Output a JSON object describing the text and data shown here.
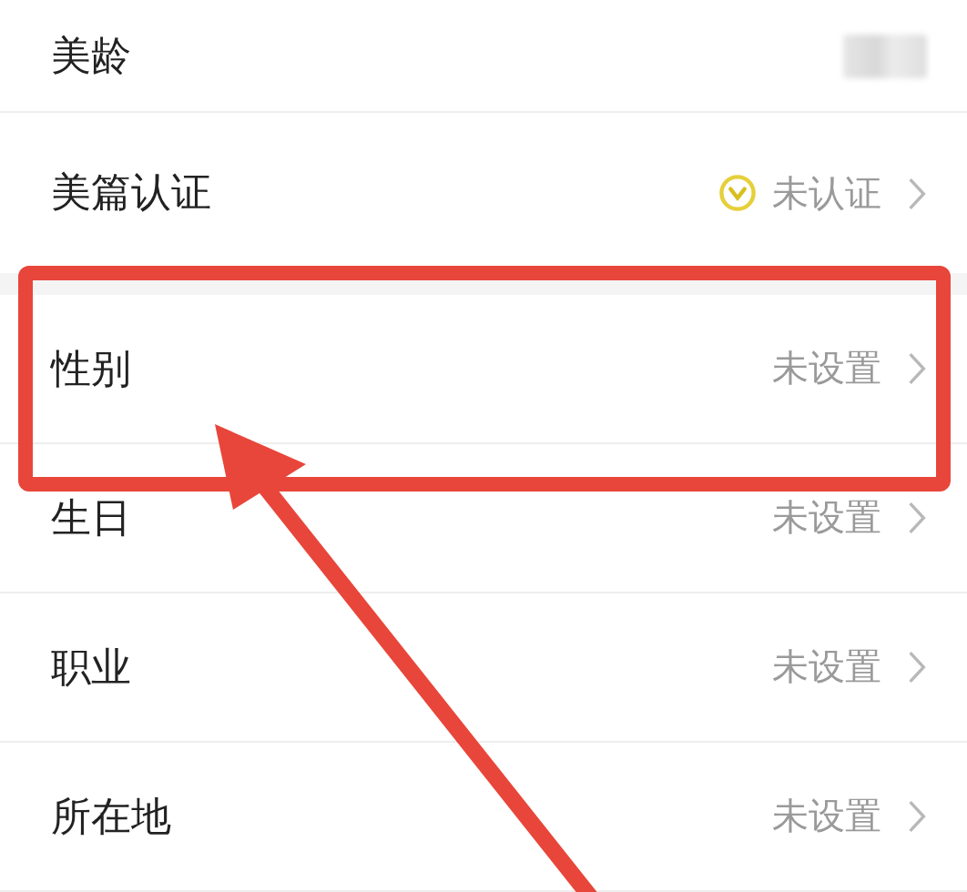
{
  "sections": [
    {
      "rows": [
        {
          "label": "美龄",
          "kind": "blurred"
        },
        {
          "label": "美篇认证",
          "kind": "verify",
          "value": "未认证"
        }
      ]
    },
    {
      "rows": [
        {
          "label": "性别",
          "kind": "plain",
          "value": "未设置"
        },
        {
          "label": "生日",
          "kind": "plain",
          "value": "未设置"
        },
        {
          "label": "职业",
          "kind": "plain",
          "value": "未设置"
        },
        {
          "label": "所在地",
          "kind": "plain",
          "value": "未设置"
        }
      ]
    }
  ]
}
